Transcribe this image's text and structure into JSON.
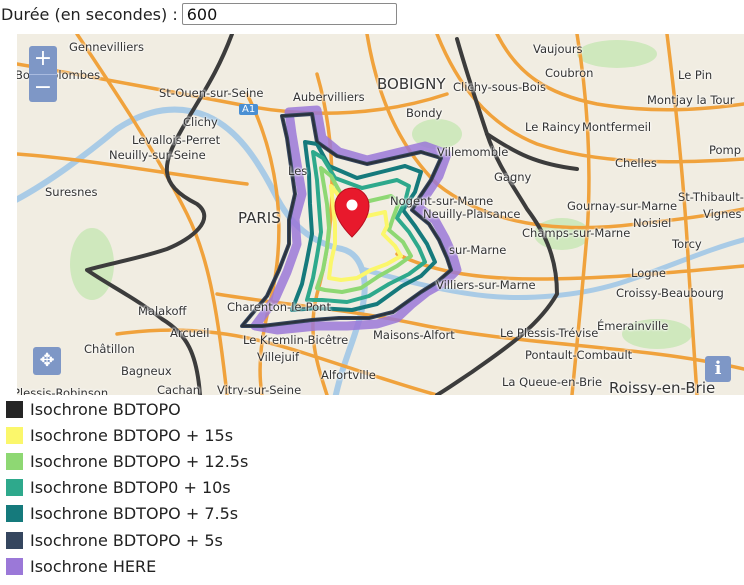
{
  "duration": {
    "label": "Durée (en secondes) :",
    "value": "600"
  },
  "map": {
    "zoom_in": "+",
    "zoom_out": "−",
    "pan_glyph": "✥",
    "info_glyph": "i",
    "places": [
      "Gennevilliers",
      "Bois-Colombes",
      "St-Ouen-sur-Seine",
      "Clichy",
      "Levallois-Perret",
      "Neuilly-sur-Seine",
      "Suresnes",
      "Aubervilliers",
      "BOBIGNY",
      "Vaujours",
      "Coubron",
      "Le Pin",
      "Clichy-sous-Bois",
      "Montjay la Tour",
      "Bondy",
      "Le Raincy",
      "Montfermeil",
      "Villemomble",
      "Pomp",
      "Chelles",
      "St-Thibault-",
      "Vignes",
      "Gagny",
      "Gournay-sur-Marne",
      "Noisiel",
      "Champs-sur-Marne",
      "Torcy",
      "PARIS",
      "Les",
      "Nogent-sur-Marne",
      "Neuilly-Plaisance",
      "sur-Marne",
      "Logne",
      "Croissy-Beaubourg",
      "Villiers-sur-Marne",
      "Malakoff",
      "Arcueil",
      "Charenton-le-Pont",
      "Maisons-Alfort",
      "Le Plessis-Trévise",
      "Émerainville",
      "Le Kremlin-Bicêtre",
      "Pontault-Combault",
      "Châtillon",
      "Villejuif",
      "Bagneux",
      "Alfortville",
      "La Queue-en-Brie",
      "Roissy-en-Brie",
      "Vitry-sur-Seine",
      "Cachan",
      "Plessis-Robinson",
      "A1"
    ],
    "marker_color": "#e8192c"
  },
  "legend": [
    {
      "label": "Isochrone BDTOPO",
      "color": "#252525"
    },
    {
      "label": "Isochrone BDTOPO + 15s",
      "color": "#fbf76b"
    },
    {
      "label": "Isochrone BDTOPO + 12.5s",
      "color": "#8ed873"
    },
    {
      "label": "Isochrone BDTOP0 + 10s",
      "color": "#2ea98c"
    },
    {
      "label": "Isochrone BDTOPO + 7.5s",
      "color": "#157a7c"
    },
    {
      "label": "Isochrone BDTOPO + 5s",
      "color": "#35465f"
    },
    {
      "label": "Isochrone HERE",
      "color": "#9b78d8"
    }
  ]
}
